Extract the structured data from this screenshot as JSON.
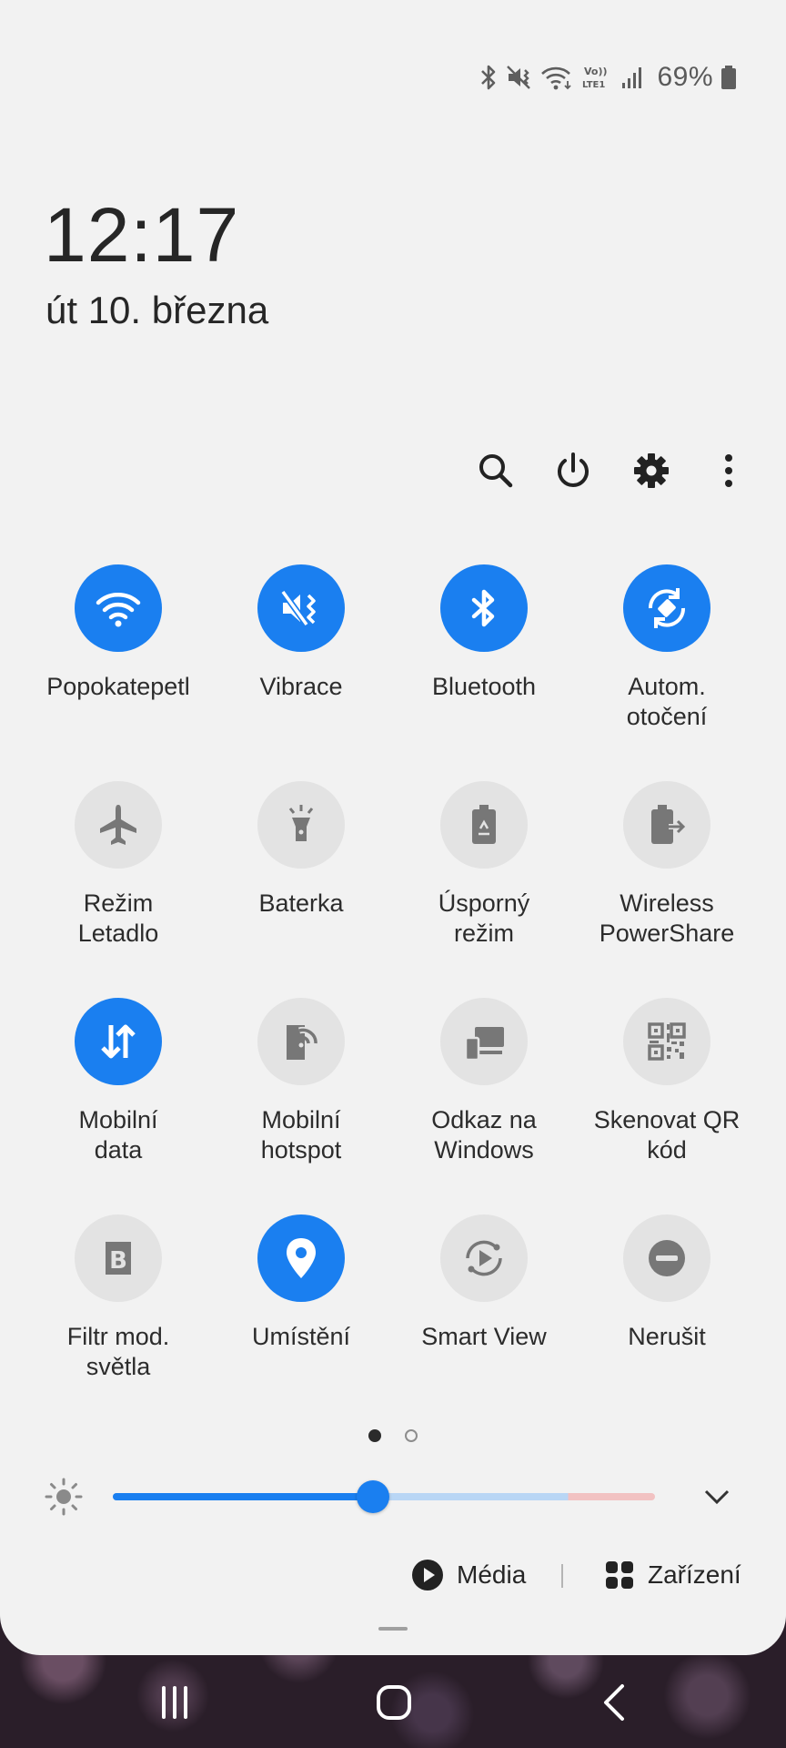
{
  "status_bar": {
    "battery_percent": "69%",
    "icons": [
      "bluetooth-icon",
      "mute-vibrate-icon",
      "wifi-icon",
      "volte-lte-icon",
      "signal-icon",
      "battery-icon"
    ],
    "volte_label": "Vo)) LTE1"
  },
  "clock": {
    "time": "12:17",
    "date": "út 10. března"
  },
  "actions": [
    {
      "name": "search-icon"
    },
    {
      "name": "power-icon"
    },
    {
      "name": "settings-icon"
    },
    {
      "name": "more-options-icon"
    }
  ],
  "tiles": [
    {
      "label": "Popokatepetl",
      "icon": "wifi-icon",
      "on": true
    },
    {
      "label": "Vibrace",
      "icon": "vibrate-icon",
      "on": true
    },
    {
      "label": "Bluetooth",
      "icon": "bluetooth-icon",
      "on": true
    },
    {
      "label": "Autom.\notočení",
      "icon": "auto-rotate-icon",
      "on": true
    },
    {
      "label": "Režim\nLetadlo",
      "icon": "airplane-icon",
      "on": false
    },
    {
      "label": "Baterka",
      "icon": "flashlight-icon",
      "on": false
    },
    {
      "label": "Úsporný\nrežim",
      "icon": "power-saving-icon",
      "on": false
    },
    {
      "label": "Wireless\nPowerShare",
      "icon": "wireless-powershare-icon",
      "on": false
    },
    {
      "label": "Mobilní\ndata",
      "icon": "mobile-data-icon",
      "on": true
    },
    {
      "label": "Mobilní\nhotspot",
      "icon": "hotspot-icon",
      "on": false
    },
    {
      "label": "Odkaz na\nWindows",
      "icon": "link-to-windows-icon",
      "on": false
    },
    {
      "label": "Skenovat QR\nkód",
      "icon": "qr-code-icon",
      "on": false
    },
    {
      "label": "Filtr mod.\nsvětla",
      "icon": "blue-light-filter-icon",
      "on": false
    },
    {
      "label": "Umístění",
      "icon": "location-icon",
      "on": true
    },
    {
      "label": "Smart View",
      "icon": "smart-view-icon",
      "on": false
    },
    {
      "label": "Nerušit",
      "icon": "do-not-disturb-icon",
      "on": false
    }
  ],
  "pagination": {
    "current_page": 1,
    "total_pages": 2
  },
  "brightness": {
    "level": 0.48
  },
  "bottom_bar": {
    "media_label": "Média",
    "devices_label": "Zařízení"
  },
  "colors": {
    "accent": "#1a7ff0",
    "panel_background": "#f2f2f2",
    "tile_off": "#e3e3e3"
  }
}
